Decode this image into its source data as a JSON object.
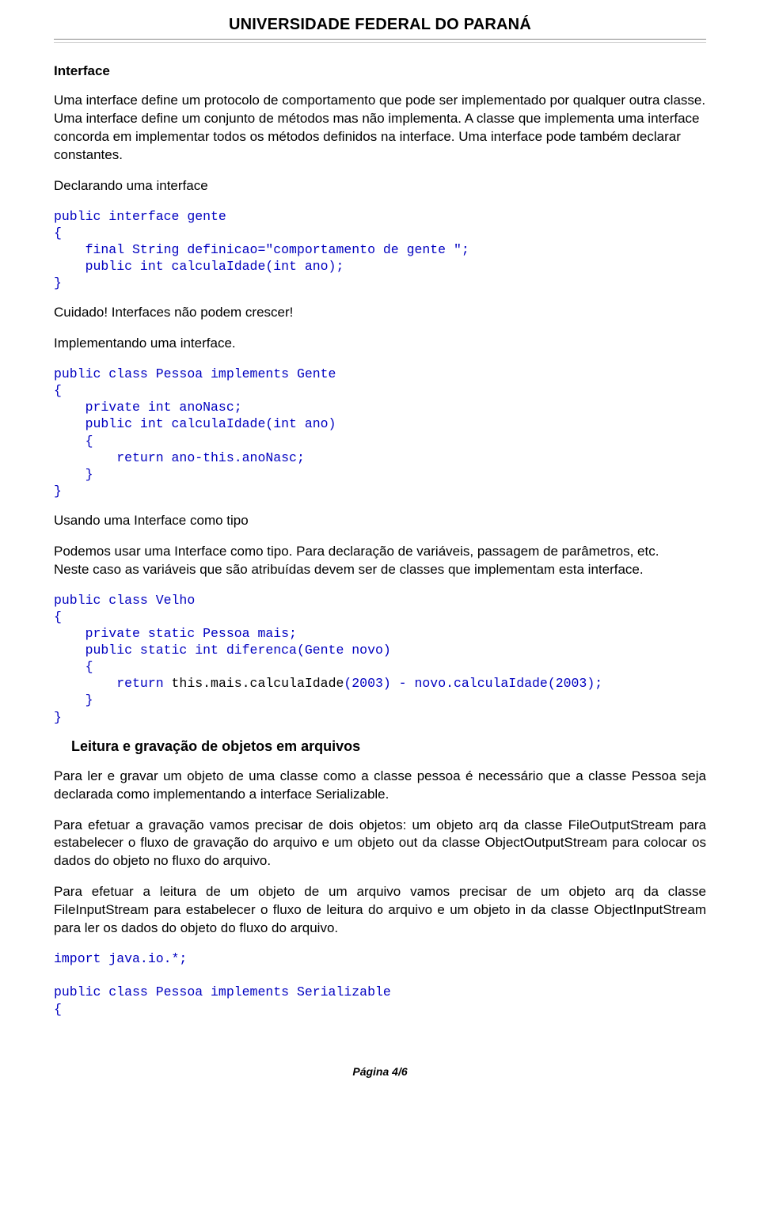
{
  "header": {
    "title": "UNIVERSIDADE FEDERAL DO PARANÁ"
  },
  "sections": {
    "interface_heading": "Interface",
    "intro_para": "Uma interface define um protocolo de comportamento que pode ser implementado por qualquer outra classe. Uma interface define um conjunto de métodos mas não implementa. A classe que implementa uma interface concorda em implementar todos os métodos definidos na interface. Uma interface pode também declarar constantes.",
    "declarando_heading": "Declarando uma interface",
    "code1": "public interface gente\n{\n    final String definicao=\"comportamento de gente \";\n    public int calculaIdade(int ano);\n}",
    "cuidado": "Cuidado! Interfaces não podem crescer!",
    "implementando_heading": "Implementando uma interface.",
    "code2": "public class Pessoa implements Gente\n{\n    private int anoNasc;\n    public int calculaIdade(int ano)\n    {\n        return ano-this.anoNasc;\n    }\n}",
    "usando_heading": "Usando uma Interface como tipo",
    "usando_para1": "Podemos usar uma Interface como tipo. Para declaração de variáveis, passagem de parâmetros, etc.",
    "usando_para2": "Neste caso as variáveis que são atribuídas devem ser de classes que implementam esta interface.",
    "code3_pre": "public class Velho\n{\n    private static Pessoa mais;\n    public static int diferenca(Gente novo)\n    {\n        return ",
    "code3_black": "this.mais.calculaIdade",
    "code3_post": "(2003) - novo.calculaIdade(2003);\n    }\n}",
    "leitura_heading": "Leitura e gravação de objetos em arquivos",
    "leitura_para1": "Para ler e gravar um objeto de uma classe como a classe pessoa é necessário que a classe Pessoa seja declarada como implementando a interface Serializable.",
    "leitura_para2": "Para efetuar a gravação vamos precisar de dois objetos: um objeto arq da classe FileOutputStream para estabelecer o fluxo de gravação do arquivo e um objeto out da classe ObjectOutputStream para colocar os dados do objeto no fluxo do arquivo.",
    "leitura_para3": "Para efetuar a leitura de um objeto de um arquivo vamos precisar de um objeto arq da classe FileInputStream para estabelecer o fluxo de leitura do arquivo e um objeto in da classe ObjectInputStream para ler os dados do objeto do fluxo do arquivo.",
    "code4": "import java.io.*;\n\npublic class Pessoa implements Serializable\n{"
  },
  "footer": {
    "page_number": "Página 4/6"
  }
}
